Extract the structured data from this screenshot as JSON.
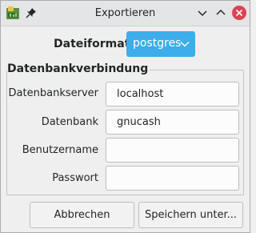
{
  "window": {
    "title": "Exportieren"
  },
  "titlebar_buttons": {
    "minimize": "chevron-down-icon",
    "maximize": "chevron-up-icon",
    "close": "close-icon"
  },
  "format": {
    "label": "Dateiformat",
    "selected": "postgres"
  },
  "connection": {
    "group_title": "Datenbankverbindung",
    "fields": [
      {
        "label": "Datenbankserver",
        "value": "localhost"
      },
      {
        "label": "Datenbank",
        "value": "gnucash"
      },
      {
        "label": "Benutzername",
        "value": ""
      },
      {
        "label": "Passwort",
        "value": ""
      }
    ]
  },
  "buttons": {
    "cancel": "Abbrechen",
    "save": "Speichern unter..."
  },
  "colors": {
    "accent": "#3daee9",
    "close": "#da4453",
    "background": "#efefef"
  }
}
